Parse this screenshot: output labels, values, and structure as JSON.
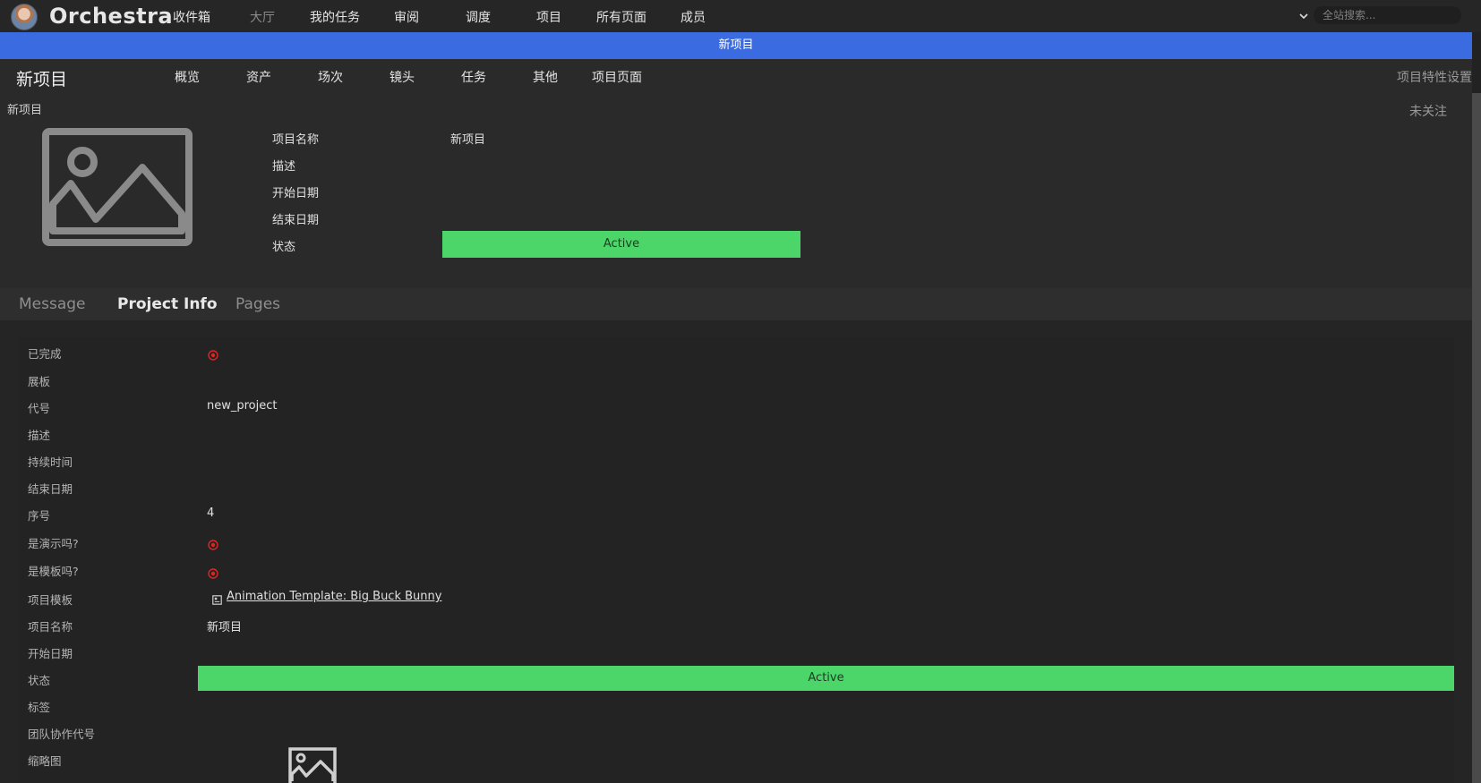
{
  "app": {
    "brand": "Orchestra",
    "nav": [
      "收件箱",
      "大厅",
      "我的任务",
      "审阅",
      "调度",
      "项目",
      "所有页面",
      "成员"
    ],
    "search_placeholder": "全站搜索..."
  },
  "banner": {
    "title": "新项目"
  },
  "project": {
    "title": "新项目",
    "tabs": [
      "概览",
      "资产",
      "场次",
      "镜头",
      "任务",
      "其他",
      "项目页面"
    ],
    "settings_label": "项目特性设置",
    "breadcrumb": "新项目",
    "follow_label": "未关注",
    "info": {
      "name_label": "项目名称",
      "name_value": "新项目",
      "desc_label": "描述",
      "start_label": "开始日期",
      "end_label": "结束日期",
      "status_label": "状态",
      "status_value": "Active"
    }
  },
  "colors": {
    "accent": "#3a6be0",
    "status_active": "#4cd568",
    "error_icon": "#e02424"
  },
  "detail_tabs": [
    "Message",
    "Project Info",
    "Pages"
  ],
  "active_detail_tab": "Project Info",
  "detail": {
    "completed_label": "已完成",
    "board_label": "展板",
    "code_label": "代号",
    "code_value": "new_project",
    "desc_label": "描述",
    "duration_label": "持续时间",
    "end_label": "结束日期",
    "order_label": "序号",
    "order_value": "4",
    "demo_label": "是演示吗?",
    "template_flag_label": "是模板吗?",
    "template_label": "项目模板",
    "template_value": "Animation Template: Big Buck Bunny",
    "name_label": "项目名称",
    "name_value": "新项目",
    "start_label": "开始日期",
    "status_label": "状态",
    "status_value": "Active",
    "tags_label": "标签",
    "team_code_label": "团队协作代号",
    "thumbnail_label": "缩略图"
  }
}
